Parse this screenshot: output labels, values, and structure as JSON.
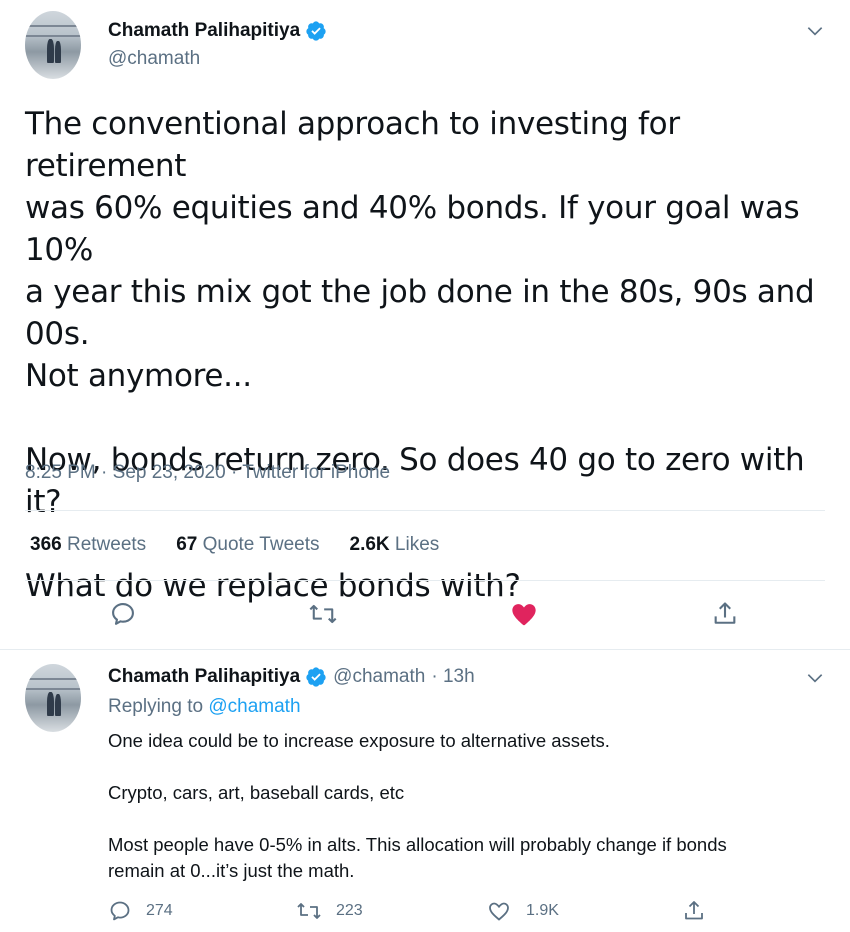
{
  "main_tweet": {
    "author": {
      "display_name": "Chamath Palihapitiya",
      "handle": "@chamath",
      "verified": true
    },
    "text_paragraphs": [
      "The conventional approach to investing for retirement\nwas 60% equities and 40% bonds. If your goal was 10%\na year this mix got the job done in the 80s, 90s and 00s.\nNot anymore...",
      "Now, bonds return zero. So does 40 go to zero with it?",
      "What do we replace bonds with?"
    ],
    "meta": "8:25 PM · Sep 23, 2020 · Twitter for iPhone",
    "stats": {
      "retweets_count": "366",
      "retweets_label": "Retweets",
      "quotes_count": "67",
      "quotes_label": "Quote Tweets",
      "likes_count": "2.6K",
      "likes_label": "Likes"
    },
    "like_color": "#e0245e"
  },
  "reply_tweet": {
    "author": {
      "display_name": "Chamath Palihapitiya",
      "handle": "@chamath",
      "time": "· 13h",
      "verified": true
    },
    "replying_prefix": "Replying to",
    "replying_to": "@chamath",
    "text_paragraphs": [
      "One idea could be to increase exposure to alternative assets.",
      "Crypto, cars, art, baseball cards, etc",
      "Most people have 0-5% in alts. This allocation will probably change if bonds\nremain at 0...it’s just the math."
    ],
    "actions": {
      "reply_count": "274",
      "retweet_count": "223",
      "like_count": "1.9K"
    }
  },
  "colors": {
    "accent": "#1da1f2",
    "secondary_text": "#5b7083",
    "divider": "#e6ecf0",
    "like": "#e0245e"
  }
}
